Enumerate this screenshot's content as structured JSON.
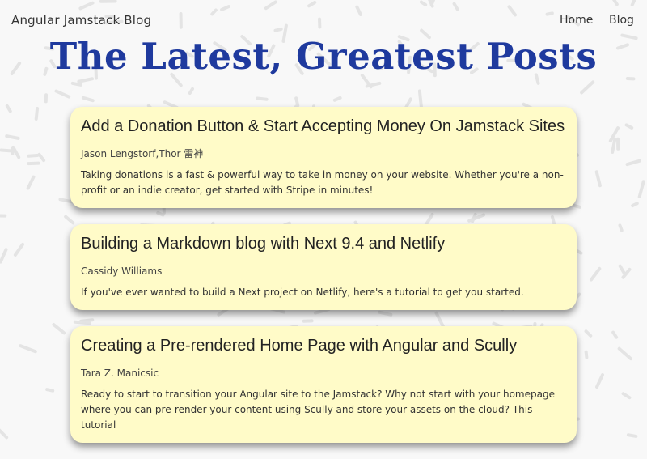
{
  "nav": {
    "brand": "Angular Jamstack Blog",
    "links": [
      "Home",
      "Blog"
    ]
  },
  "hero": {
    "title": "The Latest, Greatest Posts"
  },
  "posts": [
    {
      "title": "Add a Donation Button & Start Accepting Money On Jamstack Sites",
      "author": "Jason Lengstorf,Thor 雷神",
      "description": "Taking donations is a fast & powerful way to take in money on your website. Whether you're a non-profit or an indie creator, get started with Stripe in minutes!"
    },
    {
      "title": "Building a Markdown blog with Next 9.4 and Netlify",
      "author": "Cassidy Williams",
      "description": "If you've ever wanted to build a Next project on Netlify, here's a tutorial to get you started."
    },
    {
      "title": "Creating a Pre-rendered Home Page with Angular and Scully",
      "author": "Tara Z. Manicsic",
      "description": "Ready to start to transition your Angular site to the Jamstack? Why not start with your homepage where you can pre-render your content using Scully and store your assets on the cloud? This tutorial"
    }
  ],
  "colors": {
    "page_background": "#f8f8f8",
    "hero_title": "#1f3a9e",
    "card_background": "#fffbc8",
    "confetti": "#e4e4e4"
  }
}
